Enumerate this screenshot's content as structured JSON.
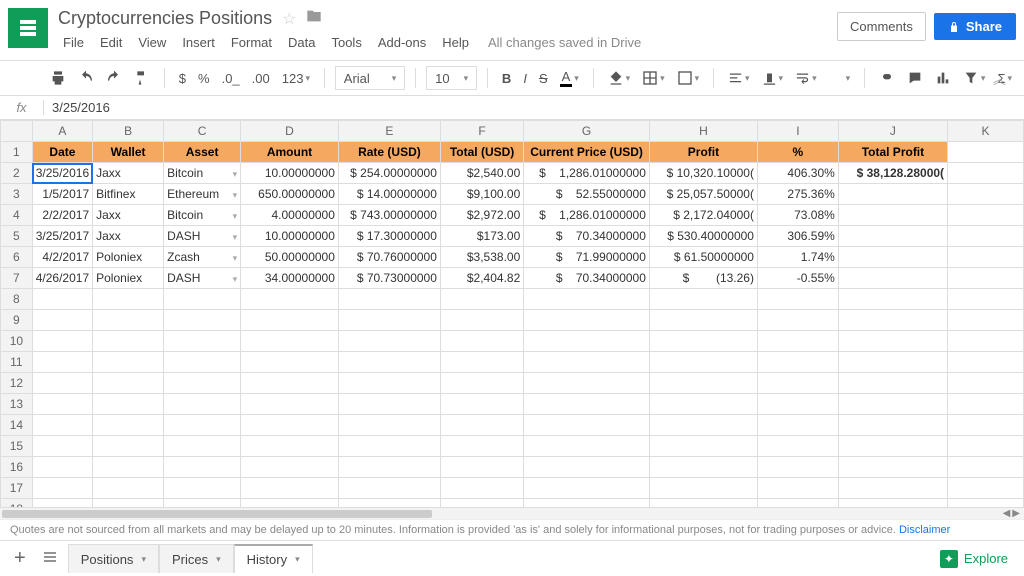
{
  "doc": {
    "title": "Cryptocurrencies Positions",
    "savedMsg": "All changes saved in Drive"
  },
  "menus": [
    "File",
    "Edit",
    "View",
    "Insert",
    "Format",
    "Data",
    "Tools",
    "Add-ons",
    "Help"
  ],
  "buttons": {
    "comments": "Comments",
    "share": "Share"
  },
  "toolbar": {
    "font": "Arial",
    "size": "10"
  },
  "fx": {
    "value": "3/25/2016"
  },
  "cols": [
    "A",
    "B",
    "C",
    "D",
    "E",
    "F",
    "G",
    "H",
    "I",
    "J",
    "K"
  ],
  "rowCount": 21,
  "headers": [
    "Date",
    "Wallet",
    "Asset",
    "Amount",
    "Rate (USD)",
    "Total (USD)",
    "Current Price (USD)",
    "Profit",
    "%",
    "Total Profit"
  ],
  "rows": [
    {
      "date": "3/25/2016",
      "wallet": "Jaxx",
      "asset": "Bitcoin",
      "amount": "10.00000000",
      "rate": "$ 254.00000000",
      "total": "$2,540.00",
      "curprice": "1,286.01000000",
      "profit": "$ 10,320.10000(",
      "pct": "406.30%",
      "tprofit": "$ 38,128.28000("
    },
    {
      "date": "1/5/2017",
      "wallet": "Bitfinex",
      "asset": "Ethereum",
      "amount": "650.00000000",
      "rate": "$ 14.00000000",
      "total": "$9,100.00",
      "curprice": "52.55000000",
      "profit": "$ 25,057.50000(",
      "pct": "275.36%",
      "tprofit": ""
    },
    {
      "date": "2/2/2017",
      "wallet": "Jaxx",
      "asset": "Bitcoin",
      "amount": "4.00000000",
      "rate": "$ 743.00000000",
      "total": "$2,972.00",
      "curprice": "1,286.01000000",
      "profit": "$ 2,172.04000(",
      "pct": "73.08%",
      "tprofit": ""
    },
    {
      "date": "3/25/2017",
      "wallet": "Jaxx",
      "asset": "DASH",
      "amount": "10.00000000",
      "rate": "$ 17.30000000",
      "total": "$173.00",
      "curprice": "70.34000000",
      "profit": "$ 530.40000000",
      "pct": "306.59%",
      "tprofit": ""
    },
    {
      "date": "4/2/2017",
      "wallet": "Poloniex",
      "asset": "Zcash",
      "amount": "50.00000000",
      "rate": "$ 70.76000000",
      "total": "$3,538.00",
      "curprice": "71.99000000",
      "profit": "$ 61.50000000",
      "pct": "1.74%",
      "tprofit": ""
    },
    {
      "date": "4/26/2017",
      "wallet": "Poloniex",
      "asset": "DASH",
      "amount": "34.00000000",
      "rate": "$ 70.73000000",
      "total": "$2,404.82",
      "curprice": "70.34000000",
      "profit": "(13.26)",
      "pct": "-0.55%",
      "tprofit": ""
    }
  ],
  "disclaimer": {
    "text": "Quotes are not sourced from all markets and may be delayed up to 20 minutes. Information is provided 'as is' and solely for informational purposes, not for trading purposes or advice. ",
    "link": "Disclaimer"
  },
  "tabs": [
    {
      "label": "Positions",
      "active": false
    },
    {
      "label": "Prices",
      "active": false
    },
    {
      "label": "History",
      "active": true
    }
  ],
  "explore": "Explore"
}
